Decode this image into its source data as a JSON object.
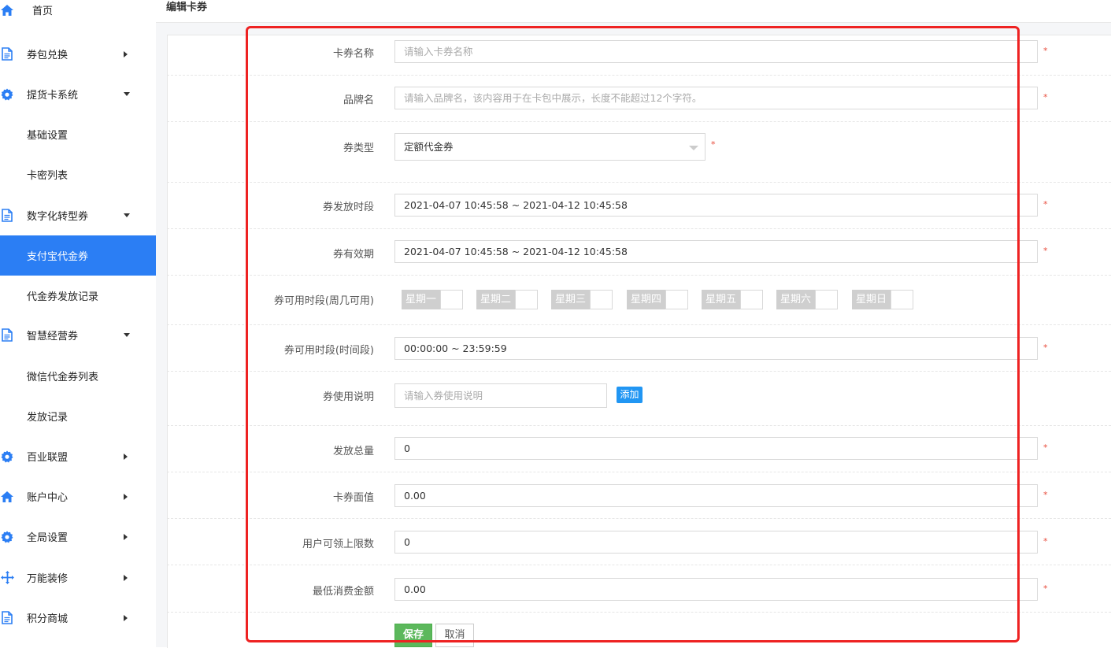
{
  "sidebar": {
    "items": [
      {
        "label": "首页",
        "icon": "home-icon",
        "arrow": ""
      },
      {
        "label": "券包兑换",
        "icon": "document-icon",
        "arrow": "right"
      },
      {
        "label": "提货卡系统",
        "icon": "gear-icon",
        "arrow": "down"
      },
      {
        "label": "基础设置",
        "icon": "",
        "arrow": ""
      },
      {
        "label": "卡密列表",
        "icon": "",
        "arrow": ""
      },
      {
        "label": "数字化转型券",
        "icon": "document-icon",
        "arrow": "down"
      },
      {
        "label": "支付宝代金券",
        "icon": "",
        "arrow": "",
        "active": true
      },
      {
        "label": "代金券发放记录",
        "icon": "",
        "arrow": ""
      },
      {
        "label": "智慧经营券",
        "icon": "document-icon",
        "arrow": "down"
      },
      {
        "label": "微信代金券列表",
        "icon": "",
        "arrow": ""
      },
      {
        "label": "发放记录",
        "icon": "",
        "arrow": ""
      },
      {
        "label": "百业联盟",
        "icon": "gear-icon",
        "arrow": "right"
      },
      {
        "label": "账户中心",
        "icon": "home-icon",
        "arrow": "right"
      },
      {
        "label": "全局设置",
        "icon": "gear-icon",
        "arrow": "right"
      },
      {
        "label": "万能装修",
        "icon": "move-icon",
        "arrow": "right"
      },
      {
        "label": "积分商城",
        "icon": "document-icon",
        "arrow": "right"
      }
    ]
  },
  "page": {
    "title": "编辑卡券"
  },
  "form": {
    "name": {
      "label": "卡券名称",
      "placeholder": "请输入卡券名称",
      "required": "*"
    },
    "brand": {
      "label": "品牌名",
      "placeholder": "请输入品牌名，该内容用于在卡包中展示，长度不能超过12个字符。",
      "required": "*"
    },
    "type": {
      "label": "券类型",
      "value": "定额代金券",
      "required": "*"
    },
    "issue_period": {
      "label": "券发放时段",
      "value": "2021-04-07 10:45:58 ~ 2021-04-12 10:45:58",
      "required": "*"
    },
    "valid_period": {
      "label": "券有效期",
      "value": "2021-04-07 10:45:58 ~ 2021-04-12 10:45:58",
      "required": "*"
    },
    "weekdays": {
      "label": "券可用时段(周几可用)",
      "days": [
        "星期一",
        "星期二",
        "星期三",
        "星期四",
        "星期五",
        "星期六",
        "星期日"
      ]
    },
    "time_range": {
      "label": "券可用时段(时间段)",
      "value": "00:00:00 ~ 23:59:59",
      "required": "*"
    },
    "usage": {
      "label": "券使用说明",
      "placeholder": "请输入券使用说明",
      "add_label": "添加"
    },
    "total": {
      "label": "发放总量",
      "value": "0",
      "required": "*"
    },
    "face_value": {
      "label": "卡券面值",
      "value": "0.00",
      "required": "*"
    },
    "user_limit": {
      "label": "用户可领上限数",
      "value": "0",
      "required": "*"
    },
    "min_spend": {
      "label": "最低消费金额",
      "value": "0.00",
      "required": "*"
    },
    "save_label": "保存",
    "cancel_label": "取消"
  },
  "colors": {
    "accent": "#2b7ef4",
    "save": "#5cb85c",
    "highlight": "#ee2222",
    "required": "#e74c3c"
  }
}
